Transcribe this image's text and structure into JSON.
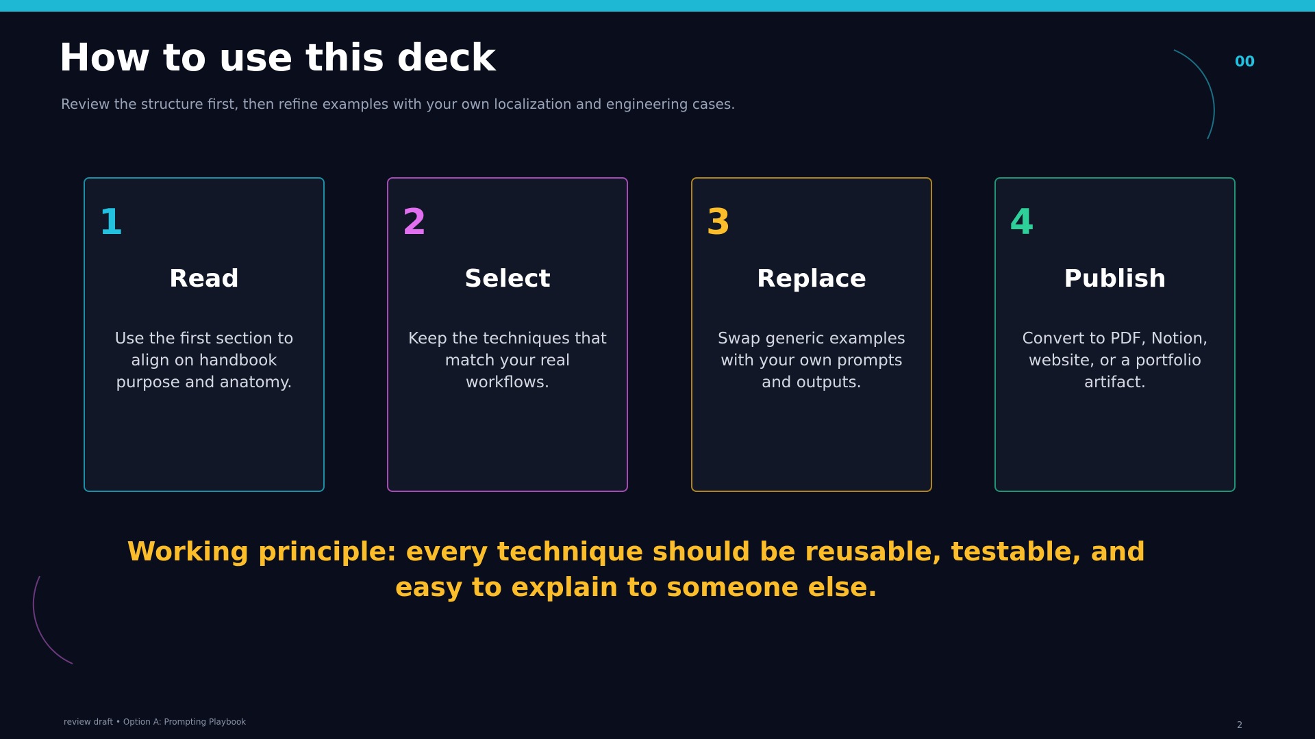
{
  "colors": {
    "background": "#0a0e1c",
    "accent_bar": "#1fb8d4",
    "principle": "#fbbd2a"
  },
  "header": {
    "title": "How to use this deck",
    "subtitle": "Review the structure first, then refine examples with your own localization and engineering cases.",
    "page_code": "00"
  },
  "steps": [
    {
      "number": "1",
      "title": "Read",
      "body": "Use the first section to align on handbook purpose and anatomy.",
      "color": "#22c1e0",
      "border": "#1a8fa6"
    },
    {
      "number": "2",
      "title": "Select",
      "body": "Keep the techniques that match your real workflows.",
      "color": "#e26ff0",
      "border": "#a64bb5"
    },
    {
      "number": "3",
      "title": "Replace",
      "body": "Swap generic examples with your own prompts and outputs.",
      "color": "#fbbd2a",
      "border": "#b08521"
    },
    {
      "number": "4",
      "title": "Publish",
      "body": "Convert to PDF, Notion, website, or a portfolio artifact.",
      "color": "#2fcf9a",
      "border": "#1f9477"
    }
  ],
  "principle": "Working principle: every technique should be reusable, testable, and easy to explain to someone else.",
  "footer": {
    "left": "review draft • Option A: Prompting Playbook",
    "page_number": "2"
  }
}
